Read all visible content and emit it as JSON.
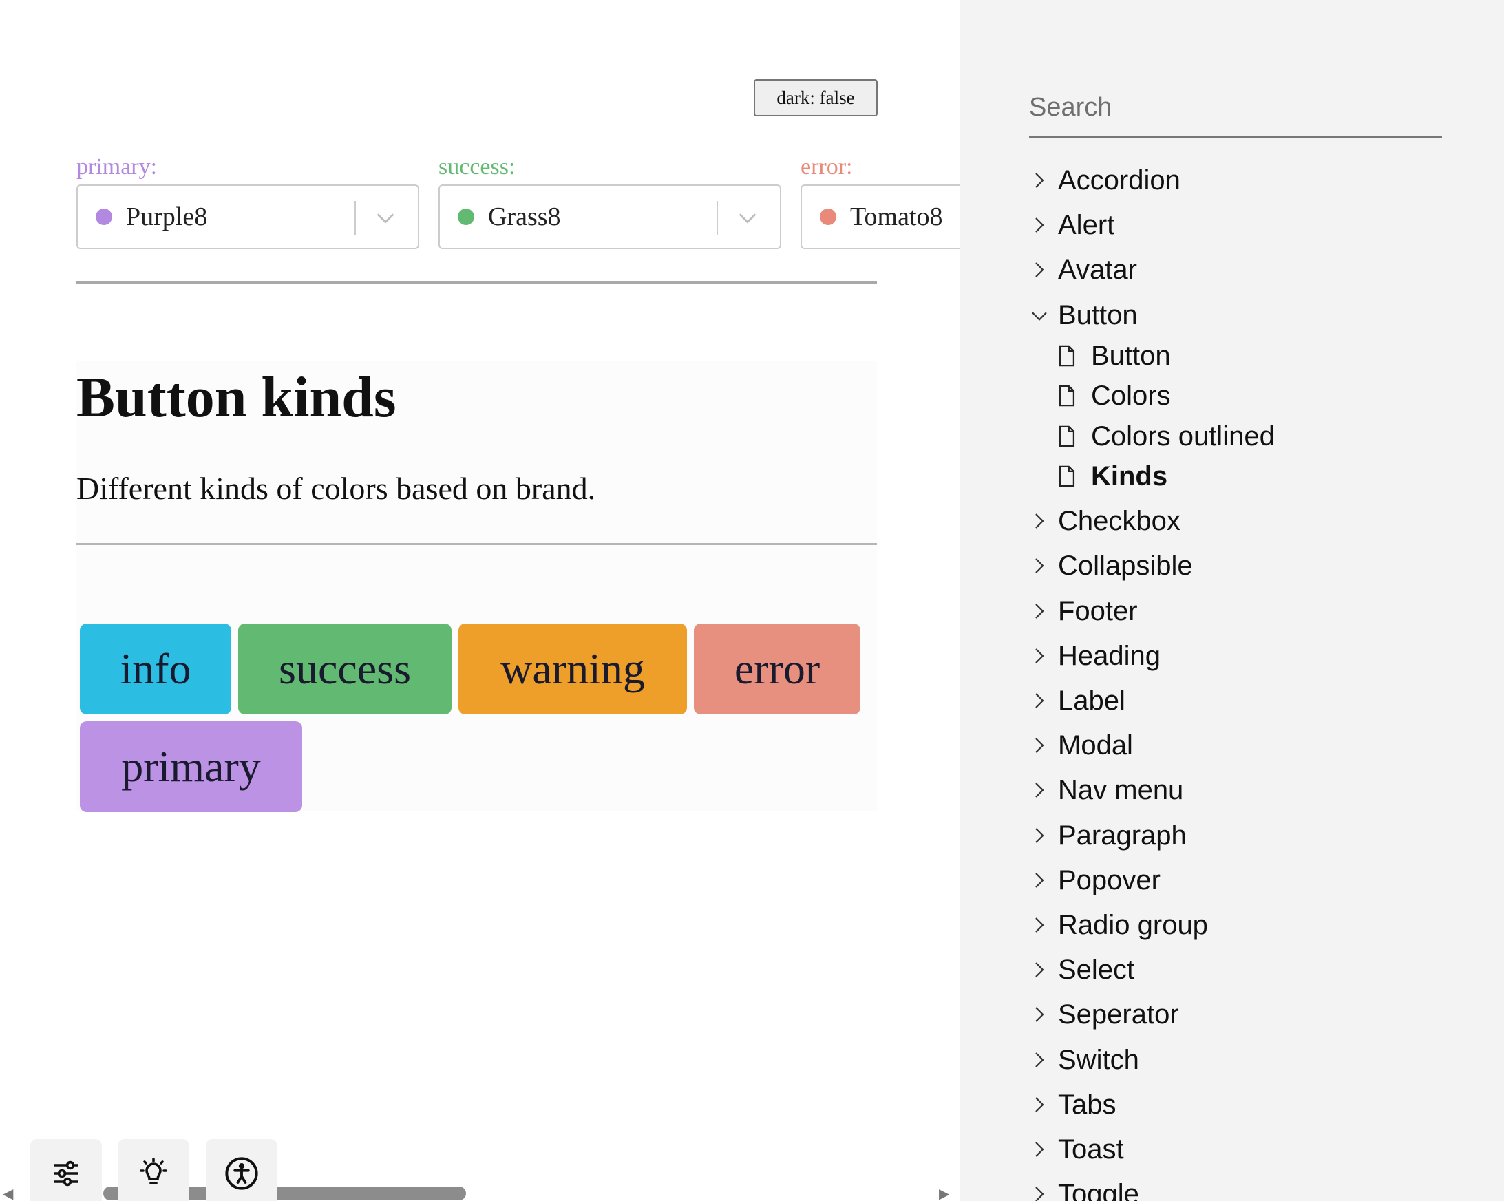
{
  "theme_toggle": {
    "label": "dark: false"
  },
  "color_pickers": [
    {
      "label": "primary:",
      "value": "Purple8",
      "color": "#b388e0"
    },
    {
      "label": "success:",
      "value": "Grass8",
      "color": "#62ba72"
    },
    {
      "label": "error:",
      "value": "Tomato8",
      "color": "#e8897a"
    }
  ],
  "story": {
    "title": "Button kinds",
    "description": "Different kinds of colors based on brand."
  },
  "kind_buttons": [
    {
      "label": "info",
      "color": "#2bbde2"
    },
    {
      "label": "success",
      "color": "#62ba72"
    },
    {
      "label": "warning",
      "color": "#ee9f2a"
    },
    {
      "label": "error",
      "color": "#e89080"
    },
    {
      "label": "primary",
      "color": "#bc93e4"
    }
  ],
  "toolbar": {
    "icons": [
      "sliders-icon",
      "lightbulb-icon",
      "accessibility-icon"
    ]
  },
  "sidebar": {
    "search_placeholder": "Search",
    "items": [
      {
        "label": "Accordion"
      },
      {
        "label": "Alert"
      },
      {
        "label": "Avatar"
      },
      {
        "label": "Button",
        "expanded": true,
        "children": [
          {
            "label": "Button"
          },
          {
            "label": "Colors"
          },
          {
            "label": "Colors outlined"
          },
          {
            "label": "Kinds",
            "active": true
          }
        ]
      },
      {
        "label": "Checkbox"
      },
      {
        "label": "Collapsible"
      },
      {
        "label": "Footer"
      },
      {
        "label": "Heading"
      },
      {
        "label": "Label"
      },
      {
        "label": "Modal"
      },
      {
        "label": "Nav menu"
      },
      {
        "label": "Paragraph"
      },
      {
        "label": "Popover"
      },
      {
        "label": "Radio group"
      },
      {
        "label": "Select"
      },
      {
        "label": "Seperator"
      },
      {
        "label": "Switch"
      },
      {
        "label": "Tabs"
      },
      {
        "label": "Toast"
      },
      {
        "label": "Toggle"
      }
    ]
  }
}
